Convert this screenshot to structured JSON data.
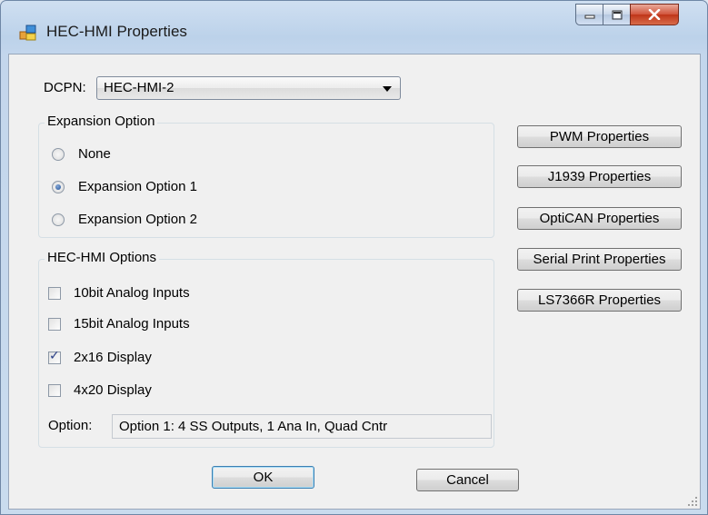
{
  "window": {
    "title": "HEC-HMI Properties"
  },
  "dcpn": {
    "label": "DCPN:",
    "value": "HEC-HMI-2"
  },
  "expansion": {
    "title": "Expansion Option",
    "options": [
      {
        "label": "None",
        "selected": false
      },
      {
        "label": "Expansion Option 1",
        "selected": true
      },
      {
        "label": "Expansion Option 2",
        "selected": false
      }
    ]
  },
  "hmi_options": {
    "title": "HEC-HMI Options",
    "items": [
      {
        "label": "10bit Analog Inputs",
        "checked": false
      },
      {
        "label": "15bit Analog Inputs",
        "checked": false
      },
      {
        "label": "2x16 Display",
        "checked": true
      },
      {
        "label": "4x20 Display",
        "checked": false
      }
    ],
    "option_label": "Option:",
    "option_value": "Option 1: 4 SS Outputs, 1 Ana In, Quad Cntr"
  },
  "side_buttons": [
    "PWM Properties",
    "J1939 Properties",
    "OptiCAN Properties",
    "Serial Print Properties",
    "LS7366R Properties"
  ],
  "buttons": {
    "ok": "OK",
    "cancel": "Cancel"
  }
}
